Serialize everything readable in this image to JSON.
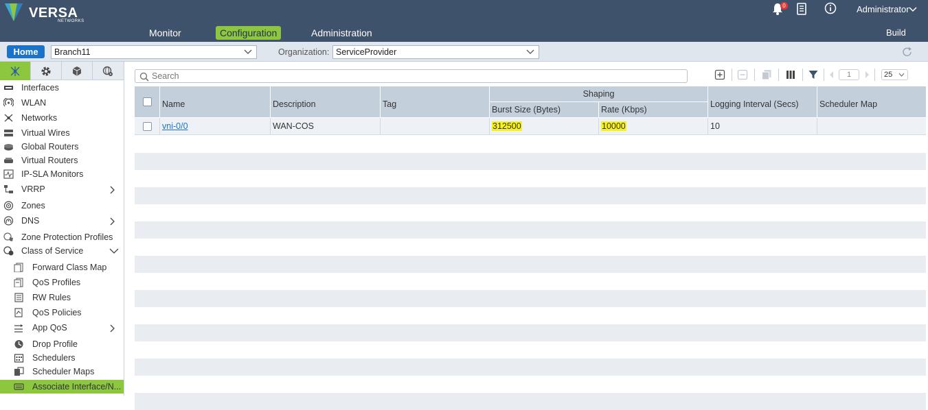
{
  "app": {
    "brand": "VERSA",
    "brand_sub": "NETWORKS",
    "notification_count": "0",
    "user": "Administrator",
    "build_label": "Build"
  },
  "nav": {
    "tabs": [
      {
        "label": "Monitor",
        "active": false
      },
      {
        "label": "Configuration",
        "active": true
      },
      {
        "label": "Administration",
        "active": false
      }
    ]
  },
  "context": {
    "home_label": "Home",
    "appliance": "Branch11",
    "org_label": "Organization:",
    "organization": "ServiceProvider"
  },
  "sidebar": {
    "tab_icons": [
      "network-icon",
      "gear-icon",
      "cube-icon",
      "globe-gear-icon"
    ],
    "items": [
      {
        "label": "Interfaces",
        "icon": "interface-icon",
        "level": 1
      },
      {
        "label": "WLAN",
        "icon": "wlan-icon",
        "level": 1
      },
      {
        "label": "Networks",
        "icon": "networks-icon",
        "level": 1
      },
      {
        "label": "Virtual Wires",
        "icon": "virtual-wires-icon",
        "level": 1
      },
      {
        "label": "Global Routers",
        "icon": "router-icon",
        "level": 1
      },
      {
        "label": "Virtual Routers",
        "icon": "virtual-router-icon",
        "level": 1
      },
      {
        "label": "IP-SLA Monitors",
        "icon": "monitor-icon",
        "level": 1
      },
      {
        "label": "VRRP",
        "icon": "vrrp-icon",
        "level": 1,
        "chevron": "right"
      },
      {
        "label": "Zones",
        "icon": "zones-icon",
        "level": 1
      },
      {
        "label": "DNS",
        "icon": "dns-icon",
        "level": 1,
        "chevron": "right"
      },
      {
        "label": "Zone Protection Profiles",
        "icon": "zone-protection-icon",
        "level": 1
      },
      {
        "label": "Class of Service",
        "icon": "cos-icon",
        "level": 1,
        "chevron": "down"
      },
      {
        "label": "Forward Class Map",
        "icon": "class-map-icon",
        "level": 2
      },
      {
        "label": "QoS Profiles",
        "icon": "qos-profile-icon",
        "level": 2
      },
      {
        "label": "RW Rules",
        "icon": "rw-rules-icon",
        "level": 2
      },
      {
        "label": "QoS Policies",
        "icon": "qos-policy-icon",
        "level": 2
      },
      {
        "label": "App QoS",
        "icon": "app-qos-icon",
        "level": 2,
        "chevron": "right"
      },
      {
        "label": "Drop Profile",
        "icon": "drop-profile-icon",
        "level": 2
      },
      {
        "label": "Schedulers",
        "icon": "scheduler-icon",
        "level": 2
      },
      {
        "label": "Scheduler Maps",
        "icon": "scheduler-map-icon",
        "level": 2
      },
      {
        "label": "Associate Interface/N...",
        "icon": "associate-icon",
        "level": 2,
        "selected": true
      }
    ]
  },
  "toolbar": {
    "search_placeholder": "Search",
    "page_number": "1",
    "page_size": "25"
  },
  "table": {
    "group_header": "Shaping",
    "columns": {
      "name": "Name",
      "description": "Description",
      "tag": "Tag",
      "burst": "Burst Size (Bytes)",
      "rate": "Rate (Kbps)",
      "logging": "Logging Interval (Secs)",
      "scheduler_map": "Scheduler Map"
    },
    "rows": [
      {
        "name": "vni-0/0",
        "description": "WAN-COS",
        "tag": "",
        "burst": "312500",
        "rate": "10000",
        "logging": "10",
        "scheduler_map": ""
      }
    ]
  },
  "colors": {
    "topbar": "#3f526b",
    "accent_green": "#8dc63f",
    "home_blue": "#1a73c8",
    "highlight_yellow": "#f7f319",
    "grid_header": "#c4cfdc"
  }
}
